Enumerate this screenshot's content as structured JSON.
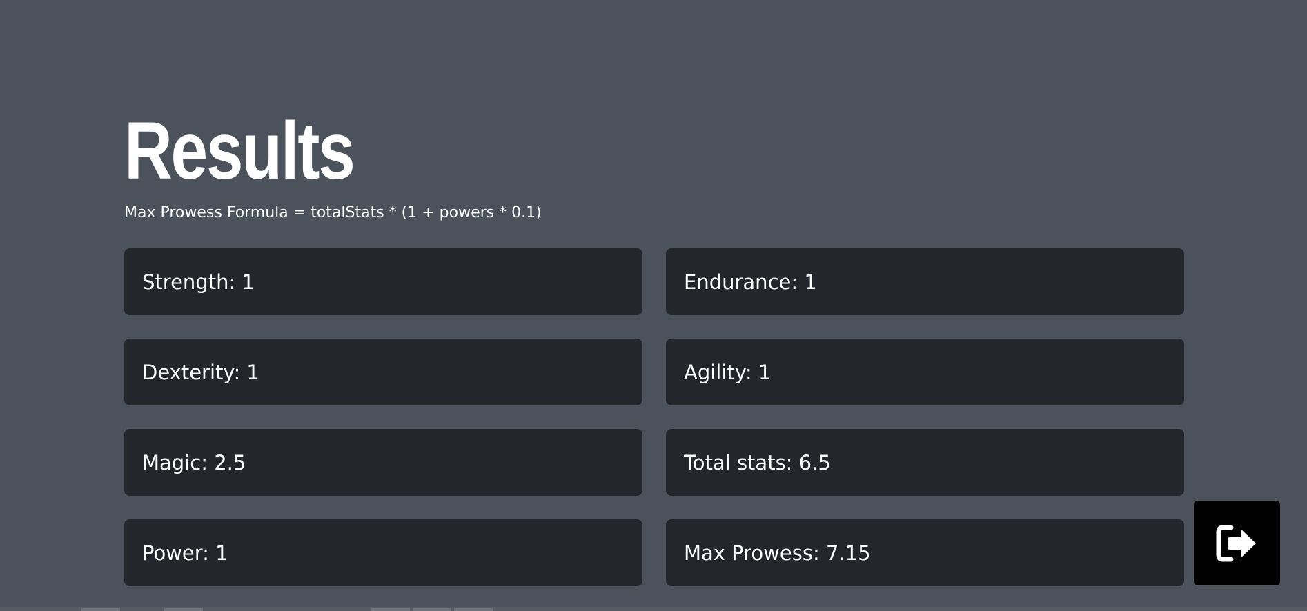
{
  "header": {
    "title": "Results",
    "formula": "Max Prowess Formula = totalStats * (1 + powers * 0.1)"
  },
  "stats": {
    "strength": "Strength: 1",
    "endurance": "Endurance: 1",
    "dexterity": "Dexterity: 1",
    "agility": "Agility: 1",
    "magic": "Magic: 2.5",
    "total_stats": "Total stats: 6.5",
    "power": "Power: 1",
    "max_prowess": "Max Prowess: 7.15"
  },
  "actions": {
    "exit_icon": "sign-out-icon"
  },
  "colors": {
    "background": "#4b525b",
    "card": "#23262b",
    "text": "#ffffff",
    "button": "#000000"
  }
}
